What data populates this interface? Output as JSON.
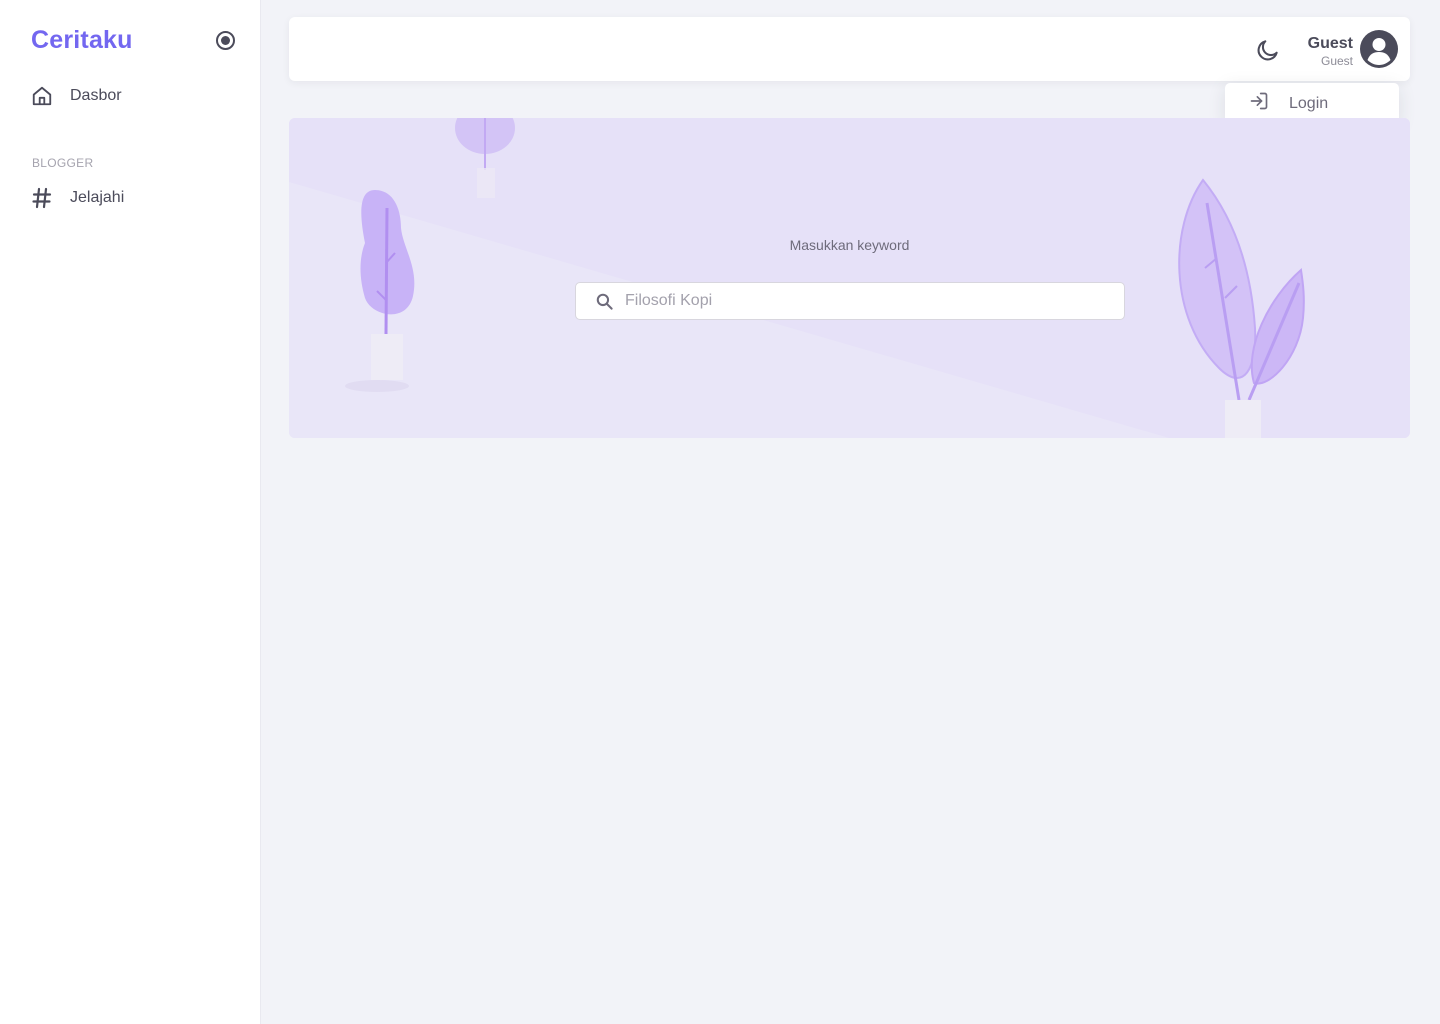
{
  "app": {
    "brand": "Ceritaku"
  },
  "sidebar": {
    "items": [
      {
        "label": "Dasbor",
        "icon": "home-icon"
      }
    ],
    "section_title": "BLOGGER",
    "section_items": [
      {
        "label": "Jelajahi",
        "icon": "hash-icon"
      }
    ],
    "collapse_icon": "radio-circle-icon"
  },
  "header": {
    "theme_icon": "moon-icon",
    "user_name": "Guest",
    "user_role": "Guest",
    "avatar_icon": "user-circle-icon",
    "menu": [
      {
        "label": "Login",
        "icon": "login-icon"
      }
    ]
  },
  "hero": {
    "title": "Masukkan keyword",
    "search_placeholder": "Filosofi Kopi",
    "search_icon": "search-icon"
  },
  "colors": {
    "accent": "#7367f0",
    "hero_bg": "#e7e2f8",
    "page_bg": "#f2f3f8"
  }
}
